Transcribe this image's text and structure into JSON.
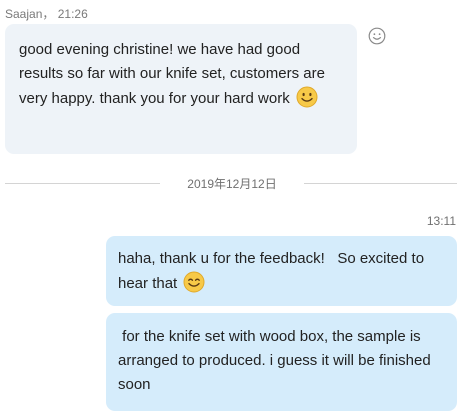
{
  "incoming_message": {
    "sender": "Saajan",
    "separator": "，",
    "time": "21:26",
    "text": "good evening christine! we have had good results so far with our knife set, customers are very happy. thank you for your hard work",
    "trailing_emoji": "smiley-face"
  },
  "reaction_button": {
    "icon": "smiley-outline-icon"
  },
  "date_divider": {
    "label": "2019年12月12日"
  },
  "outgoing_messages": {
    "time": "13:11",
    "messages": [
      {
        "text": "haha, thank u for the feedback!   So excited to hear that",
        "trailing_emoji": "smiley-face"
      },
      {
        "text": " for the knife set with wood box, the sample is arranged to produced. i guess it will be finished soon"
      }
    ]
  },
  "colors": {
    "incoming_bubble": "#eef3f8",
    "outgoing_bubble": "#d5ecfb",
    "emoji_face": "#f7c948",
    "meta_text": "#7a7a7a"
  }
}
